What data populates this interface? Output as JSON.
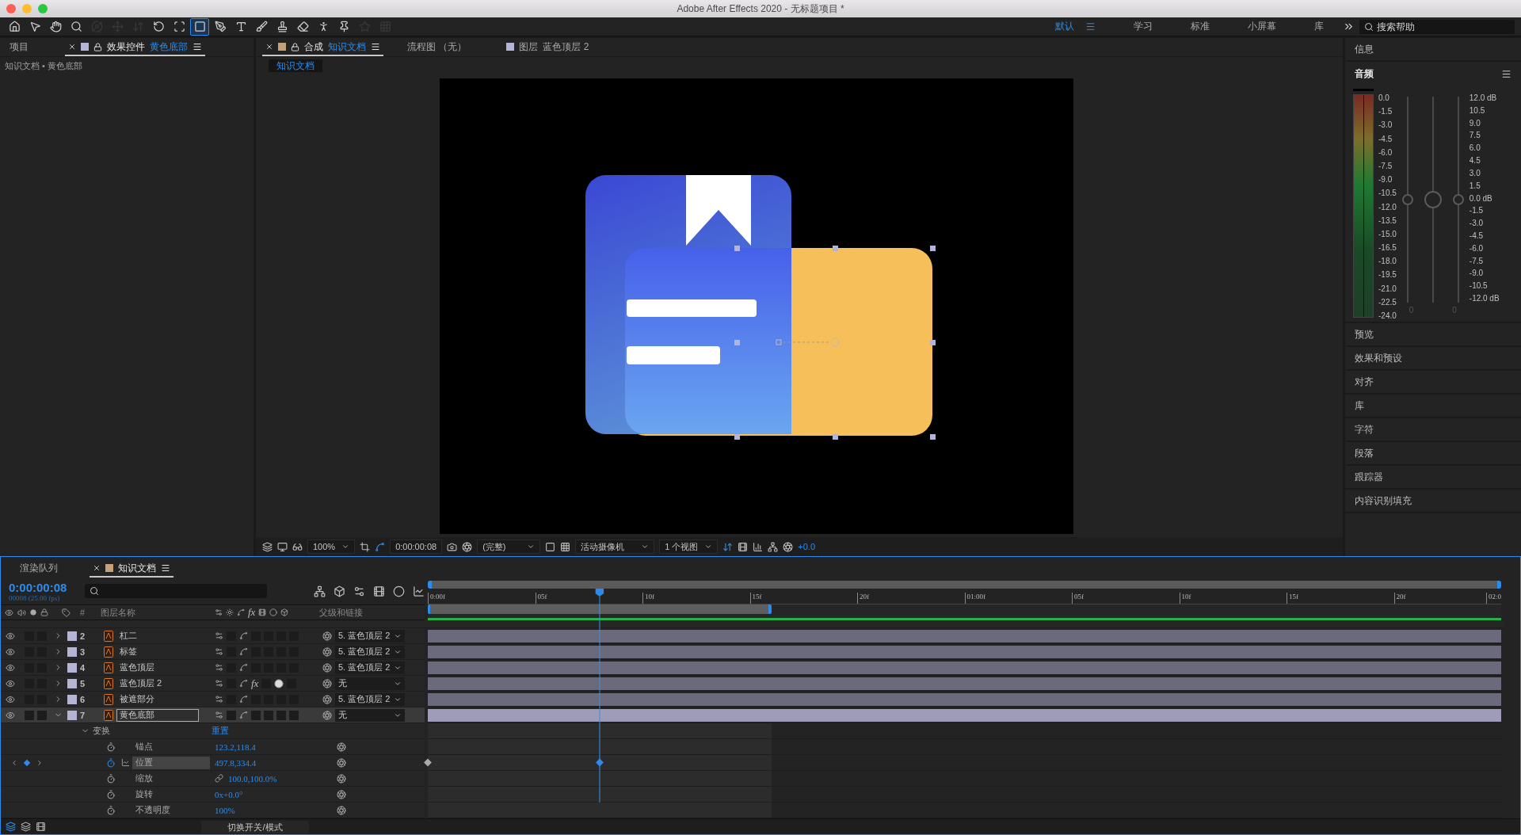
{
  "window": {
    "title": "Adobe After Effects 2020 - 无标题项目 *"
  },
  "tools": [
    {
      "selected": false,
      "disabled": false
    },
    {
      "selected": false,
      "disabled": false
    },
    {
      "selected": false,
      "disabled": false
    },
    {
      "selected": false,
      "disabled": false
    },
    {
      "selected": false,
      "disabled": true
    },
    {
      "selected": false,
      "disabled": true
    },
    {
      "selected": false,
      "disabled": true
    },
    {
      "selected": false,
      "disabled": false
    },
    {
      "selected": false,
      "disabled": false
    },
    {
      "selected": true,
      "disabled": false
    },
    {
      "selected": false,
      "disabled": false
    },
    {
      "selected": false,
      "disabled": false
    },
    {
      "selected": false,
      "disabled": false
    },
    {
      "selected": false,
      "disabled": false
    },
    {
      "selected": false,
      "disabled": false
    },
    {
      "selected": false,
      "disabled": false
    },
    {
      "selected": false,
      "disabled": false
    },
    {
      "selected": false,
      "disabled": true
    },
    {
      "selected": false,
      "disabled": true
    }
  ],
  "workspaces": [
    {
      "label": "默认",
      "selected": true
    },
    {
      "label": "学习",
      "selected": false
    },
    {
      "label": "标准",
      "selected": false
    },
    {
      "label": "小屏幕",
      "selected": false
    },
    {
      "label": "库",
      "selected": false
    }
  ],
  "help_search": {
    "placeholder": "搜索帮助"
  },
  "effects_panel": {
    "tabs": [
      {
        "label": "项目",
        "selected": false
      },
      {
        "label": "效果控件",
        "subject": "黄色底部",
        "selected": true
      }
    ],
    "breadcrumb": "知识文档 • 黄色底部"
  },
  "composition_panel": {
    "tabs": [
      {
        "label": "合成",
        "subject": "知识文档",
        "selected": true
      },
      {
        "label": "流程图 （无）",
        "selected": false
      },
      {
        "label": "图层",
        "subject": "蓝色顶层 2",
        "selected": false
      }
    ],
    "breadcrumb": "知识文档",
    "viewer": {
      "zoom": "100%",
      "time": "0:00:00:08",
      "resolution": "(完整)",
      "camera": "活动摄像机",
      "views": "1 个视图",
      "exposure": "+0.0"
    }
  },
  "right_panel": {
    "info": "信息",
    "audio": {
      "title": "音频",
      "meter_scale": [
        "0.0",
        "-1.5",
        "-3.0",
        "-4.5",
        "-6.0",
        "-7.5",
        "-9.0",
        "-10.5",
        "-12.0",
        "-13.5",
        "-15.0",
        "-16.5",
        "-18.0",
        "-19.5",
        "-21.0",
        "-22.5",
        "-24.0"
      ],
      "fader_scale": [
        "12.0 dB",
        "10.5",
        "9.0",
        "7.5",
        "6.0",
        "4.5",
        "3.0",
        "1.5",
        "0.0 dB",
        "-1.5",
        "-3.0",
        "-4.5",
        "-6.0",
        "-7.5",
        "-9.0",
        "-10.5",
        "-12.0 dB"
      ],
      "faders": [
        {
          "level": 0.5
        },
        {
          "level": 0.5
        },
        {
          "level": 0.5
        }
      ],
      "fader_readings": [
        "0",
        "0"
      ]
    },
    "panels": [
      "预览",
      "效果和预设",
      "对齐",
      "库",
      "字符",
      "段落",
      "跟踪器",
      "内容识别填充"
    ]
  },
  "timeline": {
    "tabs": [
      {
        "label": "渲染队列",
        "selected": false
      },
      {
        "label": "知识文档",
        "selected": true
      }
    ],
    "current_time": "0:00:00:08",
    "frame_info": "00008 (25.00 fps)",
    "columns": {
      "number": "#",
      "name": "图层名称",
      "fx": "fx",
      "parent": "父级和链接"
    },
    "layers": [
      {
        "number": "2",
        "name": "杠二",
        "blend": false,
        "parent": "5. 蓝色顶层 2",
        "selected": false,
        "expanded": false
      },
      {
        "number": "3",
        "name": "标签",
        "blend": false,
        "parent": "5. 蓝色顶层 2",
        "selected": false,
        "expanded": false
      },
      {
        "number": "4",
        "name": "蓝色顶层",
        "blend": false,
        "parent": "5. 蓝色顶层 2",
        "selected": false,
        "expanded": false
      },
      {
        "number": "5",
        "name": "蓝色顶层 2",
        "fx": "fx",
        "blend": true,
        "parent": "无",
        "selected": false,
        "expanded": false
      },
      {
        "number": "6",
        "name": "被遮部分",
        "blend": false,
        "parent": "5. 蓝色顶层 2",
        "selected": false,
        "expanded": false
      },
      {
        "number": "7",
        "name": "黄色底部",
        "blend": false,
        "parent": "无",
        "selected": true,
        "expanded": true
      }
    ],
    "transform": {
      "label": "变换",
      "reset": "重置",
      "properties": [
        {
          "name": "锚点",
          "value": "123.2,118.4",
          "animated": false,
          "selected": false,
          "linked": false
        },
        {
          "name": "位置",
          "value": "497.8,334.4",
          "animated": true,
          "selected": true,
          "linked": false,
          "keyframes": [
            {
              "level": 0,
              "current": false
            },
            {
              "level": 0.16,
              "current": true
            }
          ]
        },
        {
          "name": "缩放",
          "value": "100.0,100.0%",
          "animated": false,
          "selected": false,
          "linked": true
        },
        {
          "name": "旋转",
          "value": "0x+0.0°",
          "animated": false,
          "selected": false,
          "linked": false
        },
        {
          "name": "不透明度",
          "value": "100%",
          "animated": false,
          "selected": false,
          "linked": false
        }
      ]
    },
    "ruler": [
      "0:00f",
      "05f",
      "10f",
      "15f",
      "20f",
      "01:00f",
      "05f",
      "10f",
      "15f",
      "20f",
      "02:0"
    ],
    "work_area": {
      "level": 0.32
    },
    "footer": "切换开关/模式"
  }
}
